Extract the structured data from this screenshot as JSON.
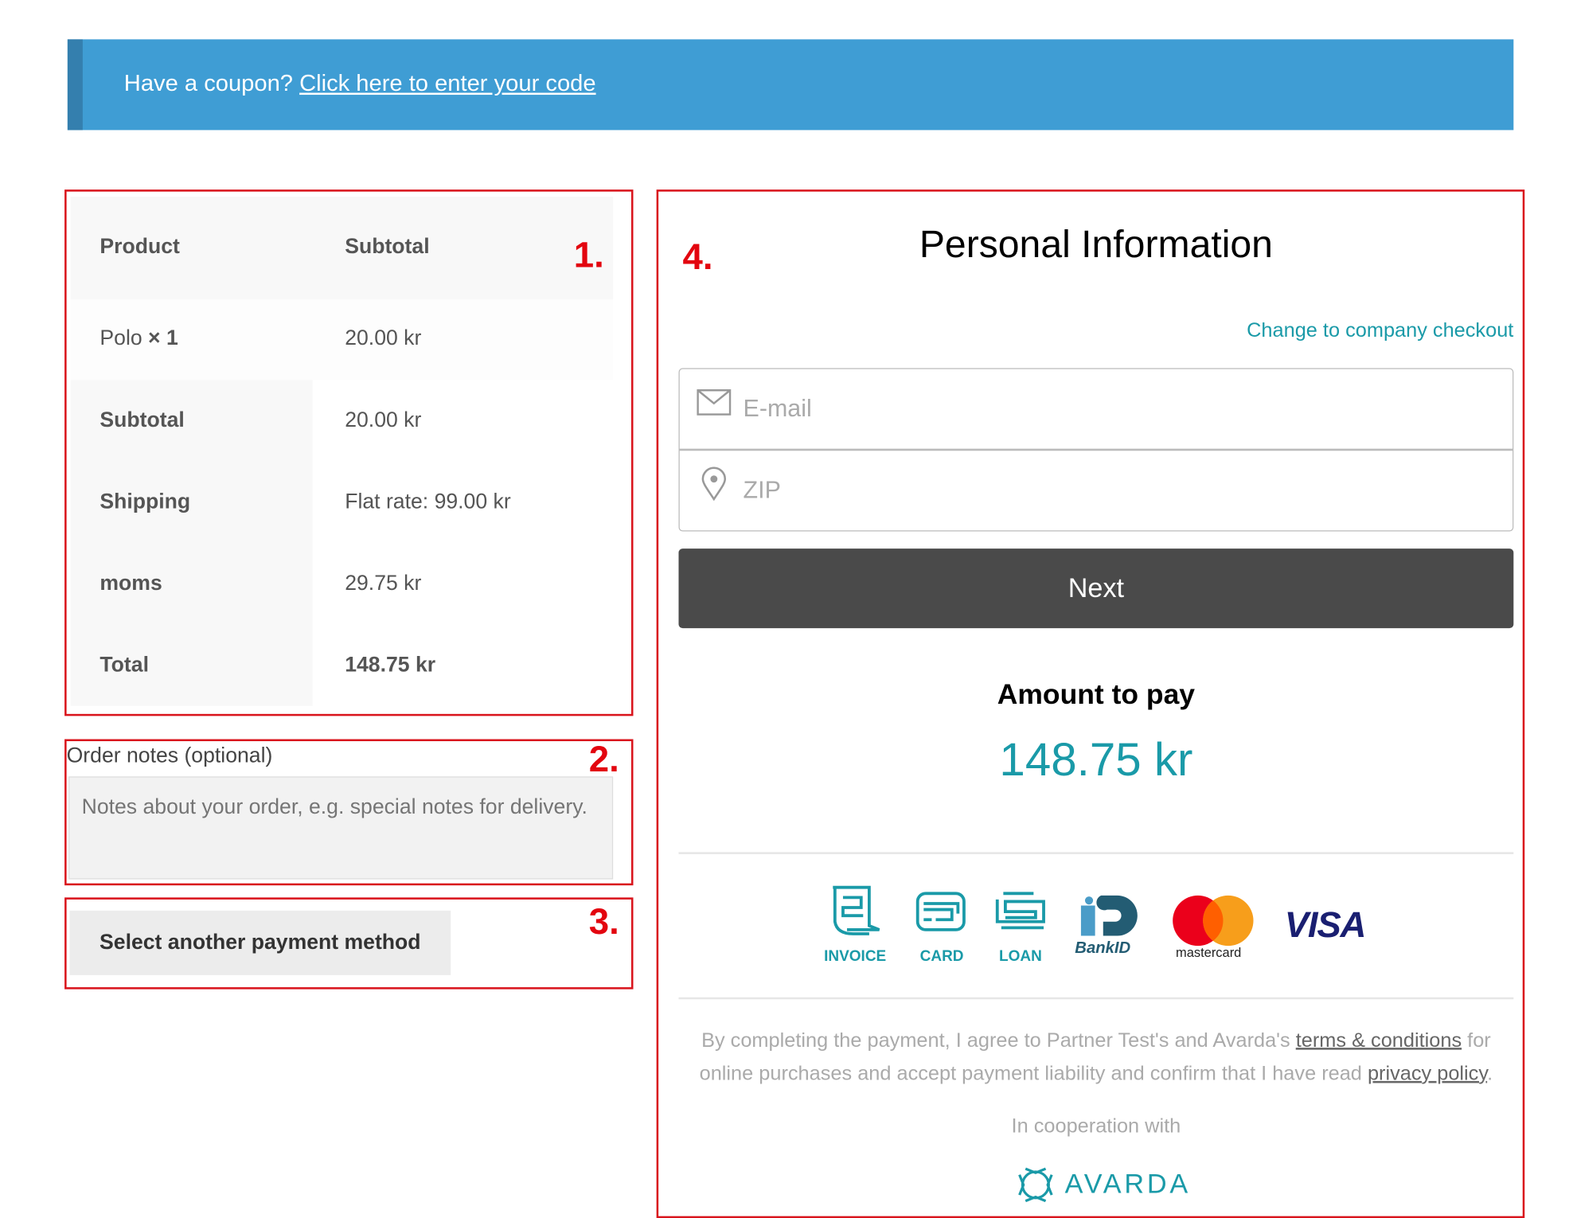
{
  "coupon": {
    "prompt": "Have a coupon?",
    "link": "Click here to enter your code"
  },
  "annotations": [
    "1.",
    "2.",
    "3.",
    "4."
  ],
  "order_table": {
    "headers": [
      "Product",
      "Subtotal"
    ],
    "item": {
      "name": "Polo",
      "qty": "× 1",
      "price": "20.00 kr"
    },
    "totals": [
      {
        "label": "Subtotal",
        "value": "20.00 kr"
      },
      {
        "label": "Shipping",
        "value": "Flat rate: 99.00 kr"
      },
      {
        "label": "moms",
        "value": "29.75 kr"
      },
      {
        "label": "Total",
        "value": "148.75 kr"
      }
    ]
  },
  "notes": {
    "label": "Order notes (optional)",
    "placeholder": "Notes about your order, e.g. special notes for delivery."
  },
  "payment_method_button": "Select another payment method",
  "checkout": {
    "title": "Personal Information",
    "company_link": "Change to company checkout",
    "email_placeholder": "E-mail",
    "zip_placeholder": "ZIP",
    "next": "Next",
    "amount_label": "Amount to pay",
    "amount": "148.75 kr",
    "methods": [
      "INVOICE",
      "CARD",
      "LOAN"
    ],
    "logos": {
      "bankid": "BankID",
      "mastercard": "mastercard",
      "visa": "VISA"
    },
    "legal": {
      "pre": "By completing the payment, I agree to Partner Test's and Avarda's ",
      "terms": "terms & conditions",
      "mid": " for online purchases and accept payment liability and confirm that I have read ",
      "privacy": "privacy policy",
      "end": "."
    },
    "cooperation": "In cooperation with",
    "brand": "AVARDA"
  },
  "colors": {
    "banner": "#3f9dd4",
    "annotation": "#e3050f",
    "teal": "#1a9aa8",
    "button": "#4a4a4a"
  }
}
